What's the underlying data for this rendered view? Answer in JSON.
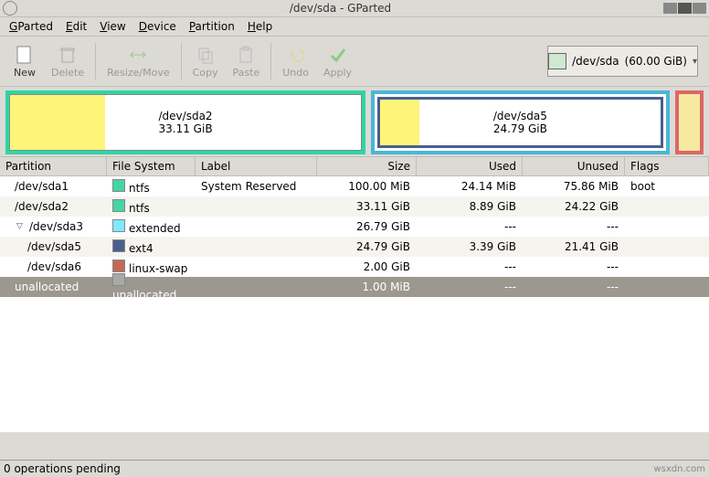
{
  "window": {
    "title": "/dev/sda - GParted"
  },
  "menus": {
    "gparted": "GParted",
    "edit": "Edit",
    "view": "View",
    "device": "Device",
    "partition": "Partition",
    "help": "Help"
  },
  "toolbar": {
    "new": "New",
    "delete": "Delete",
    "resize": "Resize/Move",
    "copy": "Copy",
    "paste": "Paste",
    "undo": "Undo",
    "apply": "Apply"
  },
  "disk_selector": {
    "device": "/dev/sda",
    "size": "(60.00 GiB)"
  },
  "viz": {
    "p1": {
      "name": "/dev/sda2",
      "size": "33.11 GiB"
    },
    "p2": {
      "name": "/dev/sda5",
      "size": "24.79 GiB"
    }
  },
  "columns": {
    "partition": "Partition",
    "fs": "File System",
    "label": "Label",
    "size": "Size",
    "used": "Used",
    "unused": "Unused",
    "flags": "Flags"
  },
  "fs_colors": {
    "ntfs": "#42d6a6",
    "extended": "#7fe9ff",
    "ext4": "#4a5e8f",
    "linux-swap": "#c26a55",
    "unallocated": "#a9a9a9"
  },
  "rows": [
    {
      "partition": "/dev/sda1",
      "fs": "ntfs",
      "label": "System Reserved",
      "size": "100.00 MiB",
      "used": "24.14 MiB",
      "unused": "75.86 MiB",
      "flags": "boot",
      "indent": 0
    },
    {
      "partition": "/dev/sda2",
      "fs": "ntfs",
      "label": "",
      "size": "33.11 GiB",
      "used": "8.89 GiB",
      "unused": "24.22 GiB",
      "flags": "",
      "indent": 0
    },
    {
      "partition": "/dev/sda3",
      "fs": "extended",
      "label": "",
      "size": "26.79 GiB",
      "used": "---",
      "unused": "---",
      "flags": "",
      "indent": 0,
      "expander": true
    },
    {
      "partition": "/dev/sda5",
      "fs": "ext4",
      "label": "",
      "size": "24.79 GiB",
      "used": "3.39 GiB",
      "unused": "21.41 GiB",
      "flags": "",
      "indent": 1
    },
    {
      "partition": "/dev/sda6",
      "fs": "linux-swap",
      "label": "",
      "size": "2.00 GiB",
      "used": "---",
      "unused": "---",
      "flags": "",
      "indent": 1
    },
    {
      "partition": "unallocated",
      "fs": "unallocated",
      "label": "",
      "size": "1.00 MiB",
      "used": "---",
      "unused": "---",
      "flags": "",
      "indent": 0,
      "selected": true
    }
  ],
  "status": {
    "text": "0 operations pending"
  },
  "watermark": "wsxdn.com"
}
